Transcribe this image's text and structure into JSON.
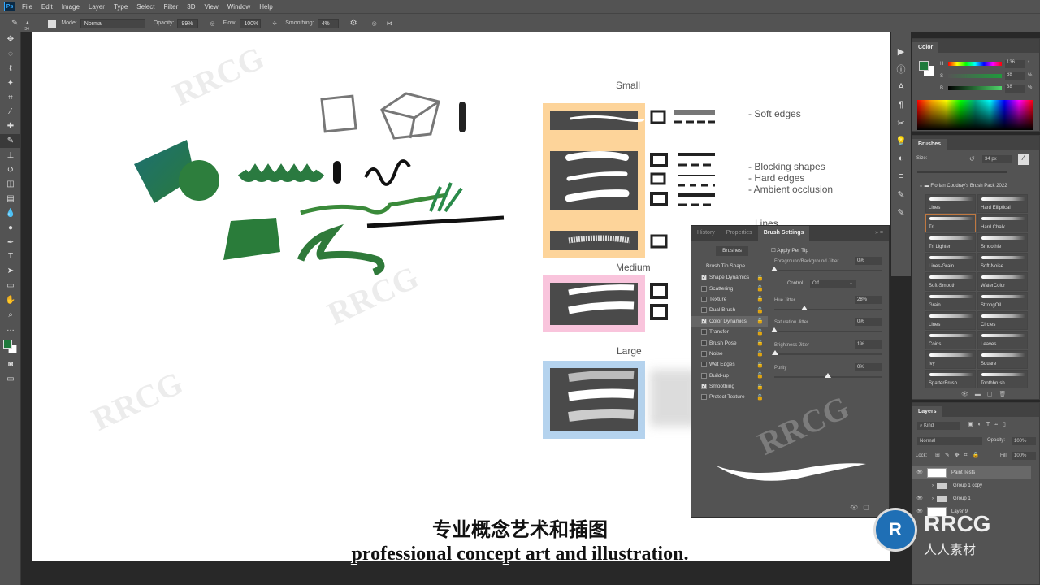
{
  "app": {
    "logo": "Ps",
    "menu": [
      "File",
      "Edit",
      "Image",
      "Layer",
      "Type",
      "Select",
      "Filter",
      "3D",
      "View",
      "Window",
      "Help"
    ]
  },
  "options": {
    "brush_size": "34",
    "mode_label": "Mode:",
    "mode": "Normal",
    "opacity_label": "Opacity:",
    "opacity": "99%",
    "flow_label": "Flow:",
    "flow": "100%",
    "smoothing_label": "Smoothing:",
    "smoothing": "4%"
  },
  "canvas": {
    "headings": {
      "small": "Small",
      "medium": "Medium",
      "large": "Large"
    },
    "notes": [
      "- Soft edges",
      "- Blocking shapes",
      "- Hard edges",
      "- Ambient occlusion",
      "Lines"
    ],
    "swatch_colors": {
      "small": "#fdd49a",
      "medium": "#f9c4dc",
      "large": "#b5d3ee"
    }
  },
  "color_panel": {
    "title": "Color",
    "h": "136",
    "s": "68",
    "b": "38",
    "h_unit": "°",
    "s_unit": "%",
    "b_unit": "%",
    "foreground": "#1f7a3c",
    "background": "#ffffff"
  },
  "brushes_panel": {
    "title": "Brushes",
    "size_label": "Size:",
    "size": "34 px",
    "group": "Florian Coudray's Brush Pack 2022",
    "items": [
      "Lines",
      "Hard Elliptical",
      "Tri",
      "Hard Chalk",
      "Tri Lighter",
      "Smoothie",
      "Lines-Grain",
      "Soft-Noise",
      "Soft-Smooth",
      "WaterColor",
      "Grain",
      "StrongOil",
      "Lines",
      "Circles",
      "Coins",
      "Leaves",
      "Ivy",
      "Square",
      "SpatterBrush",
      "Toothbrush"
    ],
    "selected": "Tri"
  },
  "brush_settings": {
    "tabs": [
      "History",
      "Properties",
      "Brush Settings"
    ],
    "active_tab": "Brush Settings",
    "brushes_button": "Brushes",
    "tip_shape": "Brush Tip Shape",
    "items": [
      {
        "label": "Shape Dynamics",
        "checked": true
      },
      {
        "label": "Scattering",
        "checked": false
      },
      {
        "label": "Texture",
        "checked": false
      },
      {
        "label": "Dual Brush",
        "checked": false
      },
      {
        "label": "Color Dynamics",
        "checked": true
      },
      {
        "label": "Transfer",
        "checked": false
      },
      {
        "label": "Brush Pose",
        "checked": false
      },
      {
        "label": "Noise",
        "checked": false
      },
      {
        "label": "Wet Edges",
        "checked": false
      },
      {
        "label": "Build-up",
        "checked": false
      },
      {
        "label": "Smoothing",
        "checked": true
      },
      {
        "label": "Protect Texture",
        "checked": false
      }
    ],
    "apply_per_tip": "Apply Per Tip",
    "control_label": "Control:",
    "control": "Off",
    "sliders": [
      {
        "label": "Foreground/Background Jitter",
        "value": "0%",
        "pct": 0
      },
      {
        "label": "Hue Jitter",
        "value": "28%",
        "pct": 28
      },
      {
        "label": "Saturation Jitter",
        "value": "0%",
        "pct": 0
      },
      {
        "label": "Brightness Jitter",
        "value": "1%",
        "pct": 1
      },
      {
        "label": "Purity",
        "value": "0%",
        "pct": 50
      }
    ]
  },
  "layers_panel": {
    "title": "Layers",
    "filter": "Kind",
    "blend": "Normal",
    "opacity_label": "Opacity:",
    "opacity": "100%",
    "lock_label": "Lock:",
    "fill_label": "Fill:",
    "fill": "100%",
    "layers": [
      {
        "name": "Paint Tests",
        "visible": true,
        "type": "layer"
      },
      {
        "name": "Group 1 copy",
        "visible": false,
        "type": "group"
      },
      {
        "name": "Group 1",
        "visible": true,
        "type": "group"
      },
      {
        "name": "Layer 9",
        "visible": true,
        "type": "layer"
      }
    ]
  },
  "subtitles": {
    "cn": "专业概念艺术和插图",
    "en": "professional concept art and illustration."
  },
  "watermark": {
    "text": "RRCG",
    "cn": "人人素材"
  }
}
